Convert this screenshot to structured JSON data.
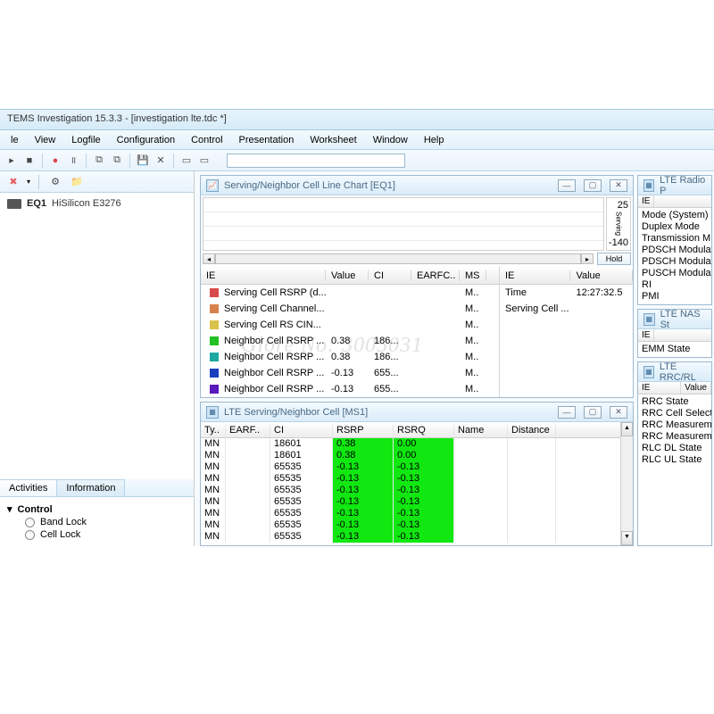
{
  "app_title": "TEMS Investigation 15.3.3 - [investigation lte.tdc *]",
  "menu": [
    "le",
    "View",
    "Logfile",
    "Configuration",
    "Control",
    "Presentation",
    "Worksheet",
    "Window",
    "Help"
  ],
  "left": {
    "device_label": "EQ1",
    "device_model": "HiSilicon E3276",
    "tabs": [
      "Activities",
      "Information"
    ],
    "tree_header": "Control",
    "tree_items": [
      "Band Lock",
      "Cell Lock"
    ]
  },
  "panel1": {
    "title": "Serving/Neighbor Cell Line Chart [EQ1]",
    "yaxis_top": "25",
    "yaxis_bottom": "-140",
    "yaxis_label": "Serving",
    "hold": "Hold",
    "headers_left": [
      "IE",
      "Value",
      "CI",
      "EARFC..",
      "MS"
    ],
    "headers_right": [
      "IE",
      "Value"
    ],
    "rows": [
      {
        "color": "#d94a4a",
        "ie": "Serving Cell RSRP (d...",
        "val": "",
        "ci": "",
        "earf": "",
        "ms": "M.."
      },
      {
        "color": "#d9814a",
        "ie": "Serving Cell Channel...",
        "val": "",
        "ci": "",
        "earf": "",
        "ms": "M.."
      },
      {
        "color": "#d9c24a",
        "ie": "Serving Cell RS CIN...",
        "val": "",
        "ci": "",
        "earf": "",
        "ms": "M.."
      },
      {
        "color": "#22c222",
        "ie": "Neighbor Cell RSRP ...",
        "val": "0.38",
        "ci": "186...",
        "earf": "",
        "ms": "M.."
      },
      {
        "color": "#1ca7a0",
        "ie": "Neighbor Cell RSRP ...",
        "val": "0.38",
        "ci": "186...",
        "earf": "",
        "ms": "M.."
      },
      {
        "color": "#1a3fbc",
        "ie": "Neighbor Cell RSRP ...",
        "val": "-0.13",
        "ci": "655...",
        "earf": "",
        "ms": "M.."
      },
      {
        "color": "#5a1abc",
        "ie": "Neighbor Cell RSRP ...",
        "val": "-0.13",
        "ci": "655...",
        "earf": "",
        "ms": "M.."
      }
    ],
    "rows_right": [
      {
        "ie": "Time",
        "val": "12:27:32.5"
      },
      {
        "ie": "Serving Cell ...",
        "val": ""
      }
    ]
  },
  "panel2": {
    "title": "LTE Serving/Neighbor Cell [MS1]",
    "headers": [
      "Ty..",
      "EARF..",
      "CI",
      "RSRP",
      "RSRQ",
      "Name",
      "Distance"
    ],
    "rows": [
      {
        "ty": "MN",
        "earf": "",
        "ci": "18601",
        "rsrp": "0.38",
        "rsrq": "0.00"
      },
      {
        "ty": "MN",
        "earf": "",
        "ci": "18601",
        "rsrp": "0.38",
        "rsrq": "0.00"
      },
      {
        "ty": "MN",
        "earf": "",
        "ci": "65535",
        "rsrp": "-0.13",
        "rsrq": "-0.13"
      },
      {
        "ty": "MN",
        "earf": "",
        "ci": "65535",
        "rsrp": "-0.13",
        "rsrq": "-0.13"
      },
      {
        "ty": "MN",
        "earf": "",
        "ci": "65535",
        "rsrp": "-0.13",
        "rsrq": "-0.13"
      },
      {
        "ty": "MN",
        "earf": "",
        "ci": "65535",
        "rsrp": "-0.13",
        "rsrq": "-0.13"
      },
      {
        "ty": "MN",
        "earf": "",
        "ci": "65535",
        "rsrp": "-0.13",
        "rsrq": "-0.13"
      },
      {
        "ty": "MN",
        "earf": "",
        "ci": "65535",
        "rsrp": "-0.13",
        "rsrq": "-0.13"
      },
      {
        "ty": "MN",
        "earf": "",
        "ci": "65535",
        "rsrp": "-0.13",
        "rsrq": "-0.13"
      }
    ]
  },
  "side1": {
    "title": "LTE Radio P",
    "hdr_ie": "IE",
    "rows": [
      "Mode (System)",
      "Duplex Mode",
      "Transmission M",
      "PDSCH Modulati",
      "PDSCH Modulati",
      "PUSCH Modulati",
      "RI",
      "PMI"
    ]
  },
  "side2": {
    "title": "LTE NAS St",
    "hdr_ie": "IE",
    "rows": [
      "EMM State"
    ]
  },
  "side3": {
    "title": "LTE RRC/RL",
    "hdr_ie": "IE",
    "hdr_val": "Value",
    "rows": [
      "RRC State",
      "RRC Cell Selecti",
      "RRC Measureme",
      "RRC Measureme",
      "RLC DL State",
      "RLC UL State"
    ]
  },
  "watermark": "Glore No: 3005031"
}
